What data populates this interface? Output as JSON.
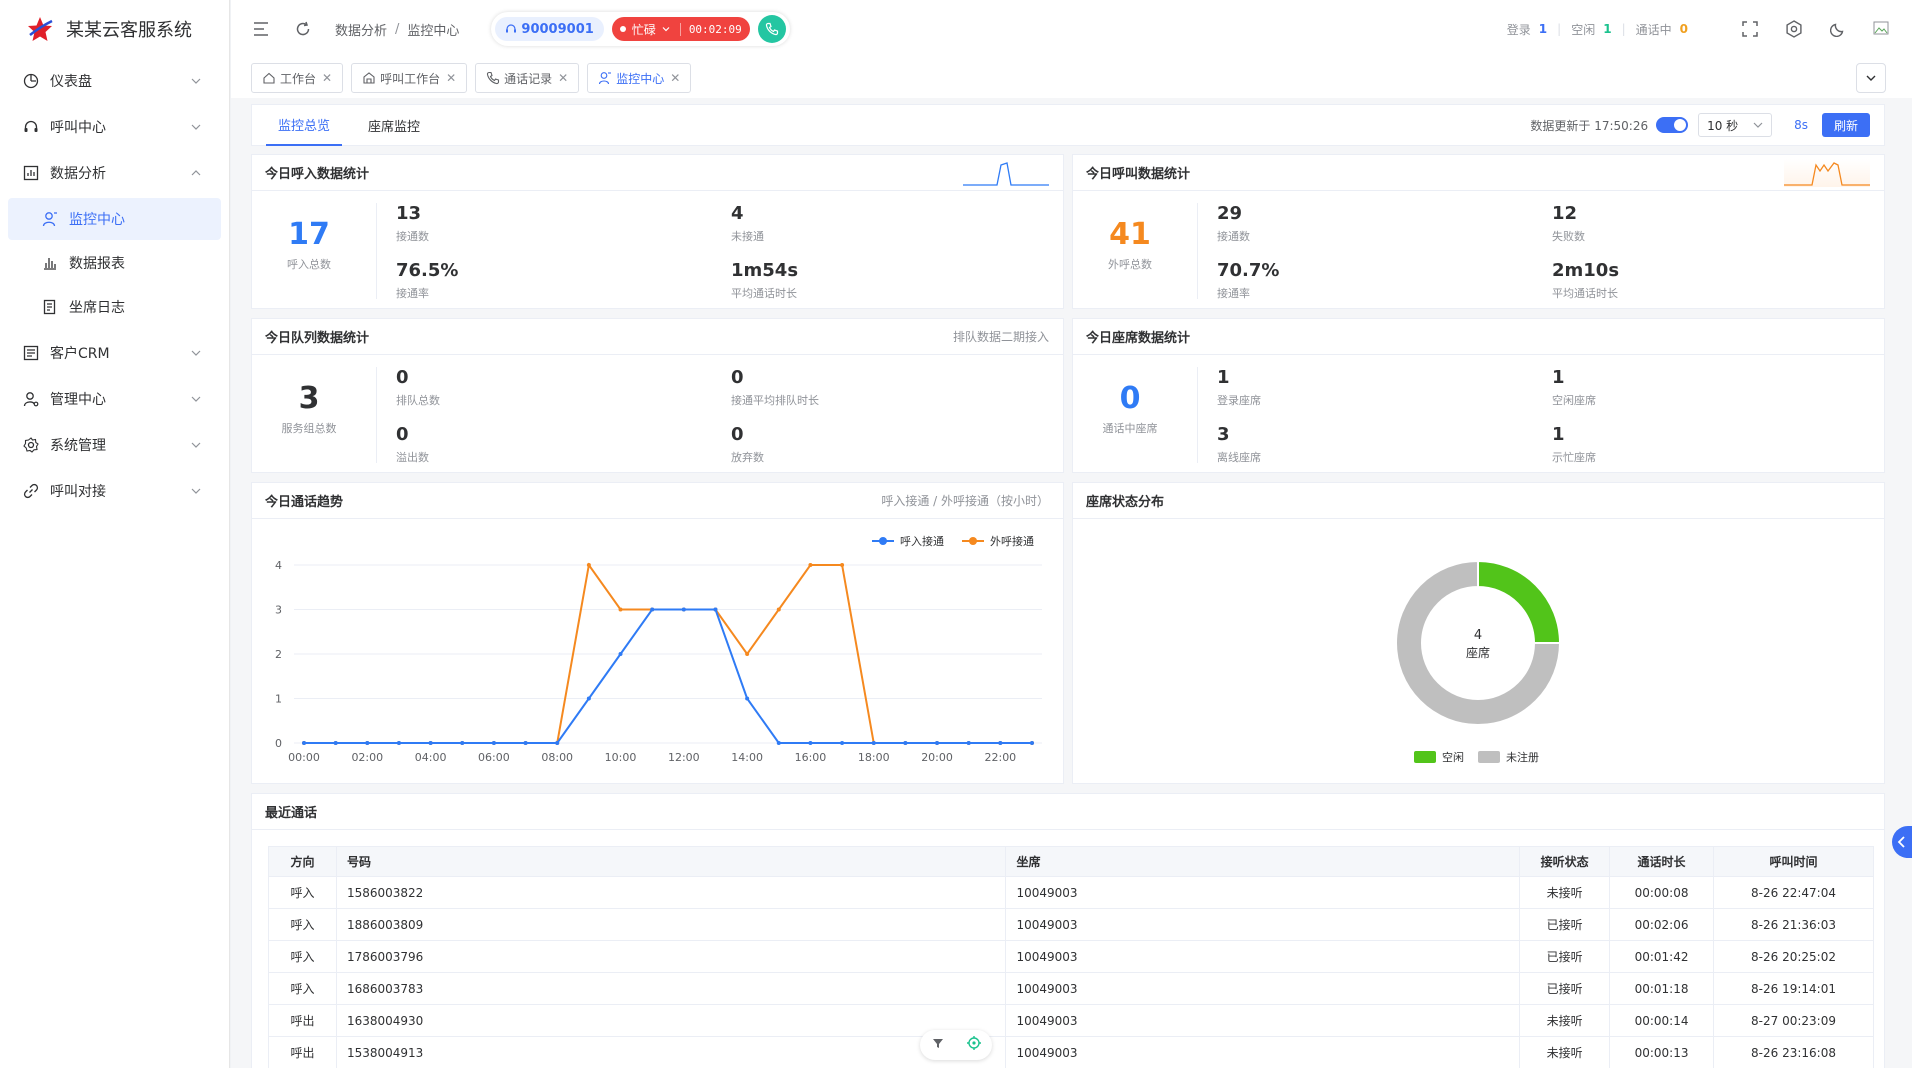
{
  "app": {
    "title": "某某云客服系统"
  },
  "sidebar": {
    "items": [
      {
        "label": "仪表盘",
        "icon": "dashboard-icon"
      },
      {
        "label": "呼叫中心",
        "icon": "headset-icon"
      },
      {
        "label": "数据分析",
        "icon": "chart-icon"
      },
      {
        "label": "客户CRM",
        "icon": "crm-icon"
      },
      {
        "label": "管理中心",
        "icon": "user-admin-icon"
      },
      {
        "label": "系统管理",
        "icon": "gear-icon"
      },
      {
        "label": "呼叫对接",
        "icon": "link-icon"
      }
    ],
    "sub_items": [
      {
        "label": "监控中心",
        "icon": "monitor-user-icon"
      },
      {
        "label": "数据报表",
        "icon": "bar-chart-icon"
      },
      {
        "label": "坐席日志",
        "icon": "log-icon"
      }
    ]
  },
  "topbar": {
    "breadcrumb": [
      "数据分析",
      "监控中心"
    ],
    "extension": "90009001",
    "status": "忙碌",
    "timer": "00:02:09",
    "counts": [
      {
        "label": "登录",
        "value": "1",
        "color": "#3c6ff5"
      },
      {
        "label": "空闲",
        "value": "1",
        "color": "#1bc28e"
      },
      {
        "label": "通话中",
        "value": "0",
        "color": "#f0a020"
      }
    ]
  },
  "tabs": [
    "工作台",
    "呼叫工作台",
    "通话记录",
    "监控中心"
  ],
  "subtabs": [
    "监控总览",
    "座席监控"
  ],
  "update": {
    "text": "数据更新于 17:50:26",
    "interval": "10 秒",
    "countdown": "8s",
    "refresh": "刷新"
  },
  "inbound": {
    "title": "今日呼入数据统计",
    "total": "17",
    "total_label": "呼入总数",
    "cells": [
      {
        "v": "13",
        "l": "接通数"
      },
      {
        "v": "4",
        "l": "未接通"
      },
      {
        "v": "76.5%",
        "l": "接通率"
      },
      {
        "v": "1m54s",
        "l": "平均通话时长"
      }
    ]
  },
  "outbound": {
    "title": "今日呼叫数据统计",
    "total": "41",
    "total_label": "外呼总数",
    "cells": [
      {
        "v": "29",
        "l": "接通数"
      },
      {
        "v": "12",
        "l": "失败数"
      },
      {
        "v": "70.7%",
        "l": "接通率"
      },
      {
        "v": "2m10s",
        "l": "平均通话时长"
      }
    ]
  },
  "queue": {
    "title": "今日队列数据统计",
    "hint": "排队数据二期接入",
    "total": "3",
    "total_label": "服务组总数",
    "cells": [
      {
        "v": "0",
        "l": "排队总数"
      },
      {
        "v": "0",
        "l": "接通平均排队时长"
      },
      {
        "v": "0",
        "l": "溢出数"
      },
      {
        "v": "0",
        "l": "放弃数"
      }
    ]
  },
  "agents": {
    "title": "今日座席数据统计",
    "total": "0",
    "total_label": "通话中座席",
    "cells": [
      {
        "v": "1",
        "l": "登录座席"
      },
      {
        "v": "1",
        "l": "空闲座席"
      },
      {
        "v": "3",
        "l": "离线座席"
      },
      {
        "v": "1",
        "l": "示忙座席"
      }
    ]
  },
  "trend": {
    "title": "今日通话趋势",
    "hint": "呼入接通 / 外呼接通（按小时）"
  },
  "dist": {
    "title": "座席状态分布"
  },
  "chart_data": [
    {
      "type": "line",
      "x": [
        "00:00",
        "01:00",
        "02:00",
        "03:00",
        "04:00",
        "05:00",
        "06:00",
        "07:00",
        "08:00",
        "09:00",
        "10:00",
        "11:00",
        "12:00",
        "13:00",
        "14:00",
        "15:00",
        "16:00",
        "17:00",
        "18:00",
        "19:00",
        "20:00",
        "21:00",
        "22:00",
        "23:00"
      ],
      "x_tick_labels": [
        "00:00",
        "02:00",
        "04:00",
        "06:00",
        "08:00",
        "10:00",
        "12:00",
        "14:00",
        "16:00",
        "18:00",
        "20:00",
        "22:00"
      ],
      "y_tick_labels": [
        "0",
        "1",
        "2",
        "3",
        "4"
      ],
      "ylim": [
        0,
        4
      ],
      "legend_position": "top-right",
      "series": [
        {
          "name": "呼入接通",
          "color": "#2f7bf5",
          "values": [
            0,
            0,
            0,
            0,
            0,
            0,
            0,
            0,
            0,
            1,
            2,
            3,
            3,
            3,
            1,
            0,
            0,
            0,
            0,
            0,
            0,
            0,
            0,
            0
          ]
        },
        {
          "name": "外呼接通",
          "color": "#f5891f",
          "values": [
            0,
            0,
            0,
            0,
            0,
            0,
            0,
            0,
            0,
            4,
            3,
            3,
            3,
            3,
            2,
            3,
            4,
            4,
            0,
            0,
            0,
            0,
            0,
            0
          ]
        }
      ]
    },
    {
      "type": "pie",
      "center_value": "4",
      "center_label": "座席",
      "legend_position": "bottom",
      "series": [
        {
          "name": "空闲",
          "value": 1,
          "color": "#52c41a"
        },
        {
          "name": "未注册",
          "value": 3,
          "color": "#bfbfbf"
        }
      ]
    }
  ],
  "recent": {
    "title": "最近通话",
    "columns": [
      "方向",
      "号码",
      "坐席",
      "接听状态",
      "通话时长",
      "呼叫时间"
    ],
    "rows": [
      {
        "dir": "呼入",
        "num": "1586003822",
        "agent": "10049003",
        "status": "未接听",
        "dur": "00:00:08",
        "time": "8-26 22:47:04"
      },
      {
        "dir": "呼入",
        "num": "1886003809",
        "agent": "10049003",
        "status": "已接听",
        "dur": "00:02:06",
        "time": "8-26 21:36:03"
      },
      {
        "dir": "呼入",
        "num": "1786003796",
        "agent": "10049003",
        "status": "已接听",
        "dur": "00:01:42",
        "time": "8-26 20:25:02"
      },
      {
        "dir": "呼入",
        "num": "1686003783",
        "agent": "10049003",
        "status": "已接听",
        "dur": "00:01:18",
        "time": "8-26 19:14:01"
      },
      {
        "dir": "呼出",
        "num": "1638004930",
        "agent": "10049003",
        "status": "未接听",
        "dur": "00:00:14",
        "time": "8-27 00:23:09"
      },
      {
        "dir": "呼出",
        "num": "1538004913",
        "agent": "10049003",
        "status": "未接听",
        "dur": "00:00:13",
        "time": "8-26 23:16:08"
      }
    ]
  }
}
